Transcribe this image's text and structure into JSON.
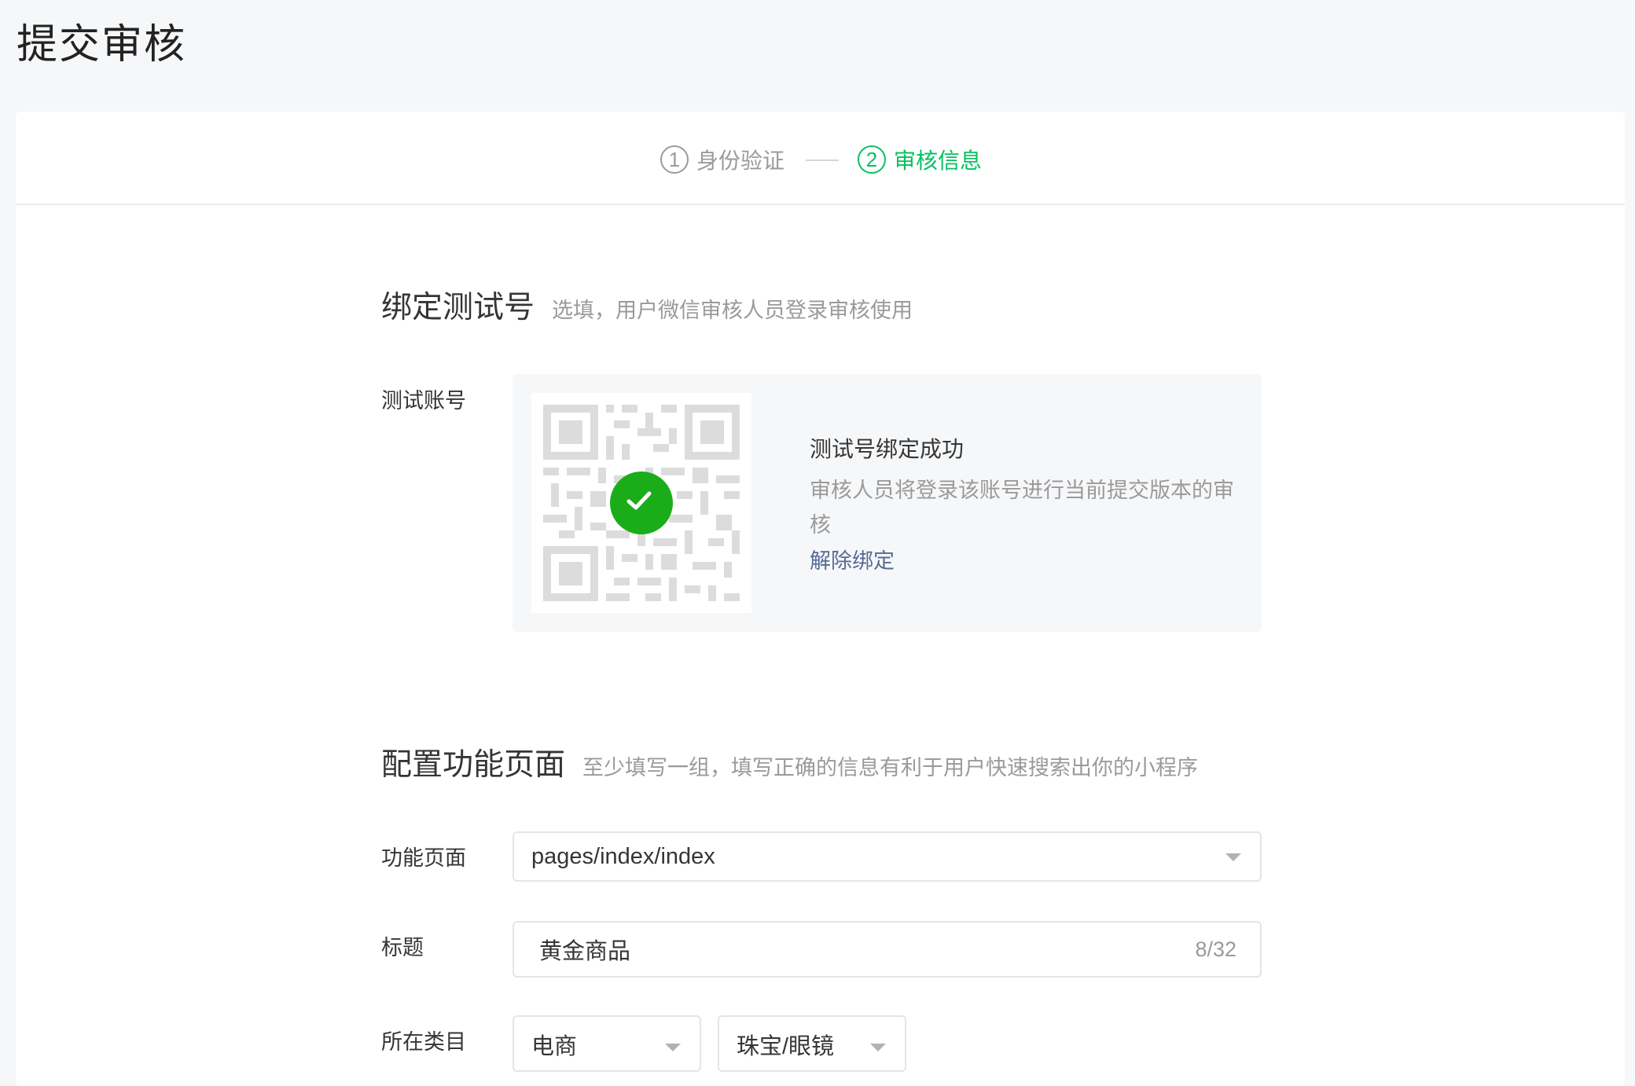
{
  "page": {
    "title": "提交审核"
  },
  "steps": [
    {
      "num": "1",
      "label": "身份验证",
      "active": false
    },
    {
      "num": "2",
      "label": "审核信息",
      "active": true
    }
  ],
  "bind_section": {
    "title": "绑定测试号",
    "desc": "选填，用户微信审核人员登录审核使用",
    "field_label": "测试账号",
    "success_title": "测试号绑定成功",
    "success_desc": "审核人员将登录该账号进行当前提交版本的审核",
    "unbind_link": "解除绑定"
  },
  "config_section": {
    "title": "配置功能页面",
    "desc": "至少填写一组，填写正确的信息有利于用户快速搜索出你的小程序",
    "page_label": "功能页面",
    "page_value": "pages/index/index",
    "title_label": "标题",
    "title_value": "黄金商品",
    "title_counter": "8/32",
    "category_label": "所在类目",
    "category_1": "电商",
    "category_2": "珠宝/眼镜"
  },
  "colors": {
    "accent": "#07c160",
    "check": "#1aad19",
    "link": "#576b95"
  }
}
